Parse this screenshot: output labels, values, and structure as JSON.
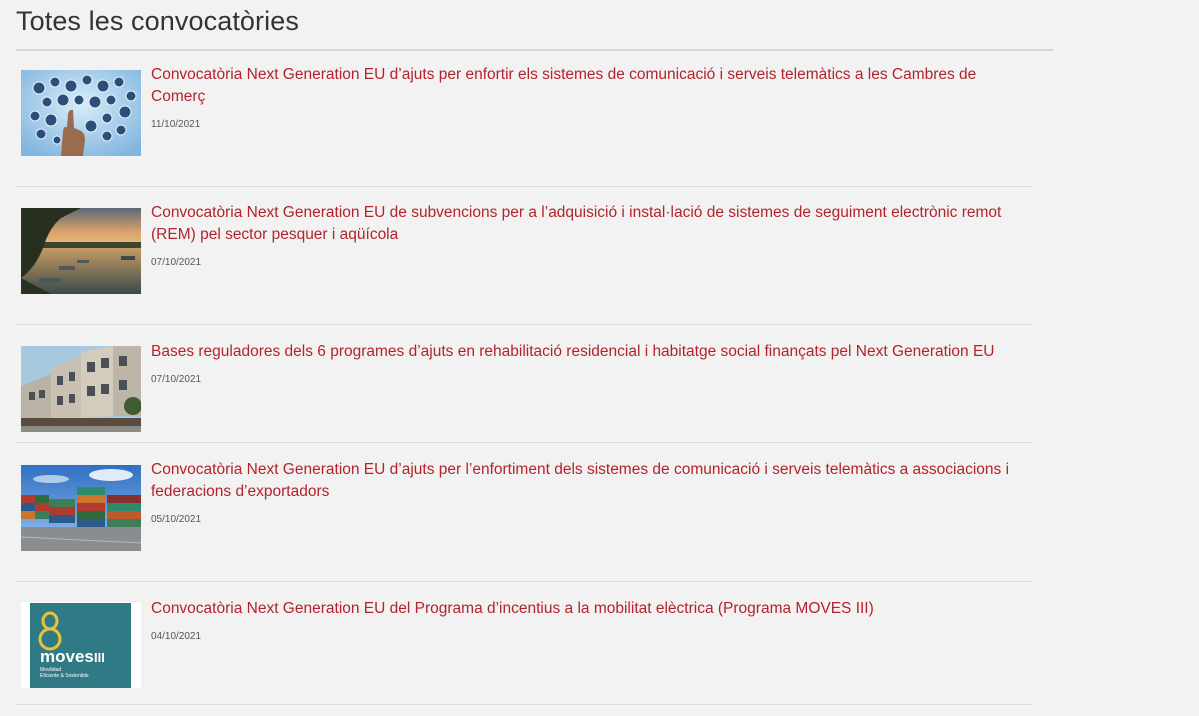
{
  "page": {
    "title": "Totes les convocatòries"
  },
  "items": [
    {
      "title": "Convocatòria Next Generation EU d’ajuts per enfortir els sistemes de comunicació i serveis telemàtics a les Cambres de Comerç",
      "date": "11/10/2021",
      "image": "digital-network-hand-image"
    },
    {
      "title": "Convocatòria Next Generation EU de subvencions per a l’adquisició i instal·lació de sistemes de seguiment electrònic remot (REM) pel sector pesquer i aqüícola",
      "date": "07/10/2021",
      "image": "lake-boats-sunset-image"
    },
    {
      "title": "Bases reguladores dels 6 programes d’ajuts en rehabilitació residencial i habitatge social finançats pel Next Generation EU",
      "date": "07/10/2021",
      "image": "townhouses-image"
    },
    {
      "title": "Convocatòria Next Generation EU d’ajuts per l’enfortiment dels sistemes de comunicació i serveis telemàtics a associacions i federacions d’exportadors",
      "date": "05/10/2021",
      "image": "shipping-containers-image"
    },
    {
      "title": "Convocatòria Next Generation EU del Programa d’incentius a la mobilitat elèctrica (Programa MOVES III)",
      "date": "04/10/2021",
      "image": "moves-iii-logo",
      "logo": {
        "word": "moves",
        "numeral": "III",
        "tagline_1": "Movilidad",
        "tagline_2": "Eficiente & Sostenible"
      }
    }
  ],
  "colors": {
    "link": "#b3232b",
    "background": "#f2f2f2",
    "moves_teal": "#2f7a84",
    "moves_yellow": "#e8c33a"
  }
}
